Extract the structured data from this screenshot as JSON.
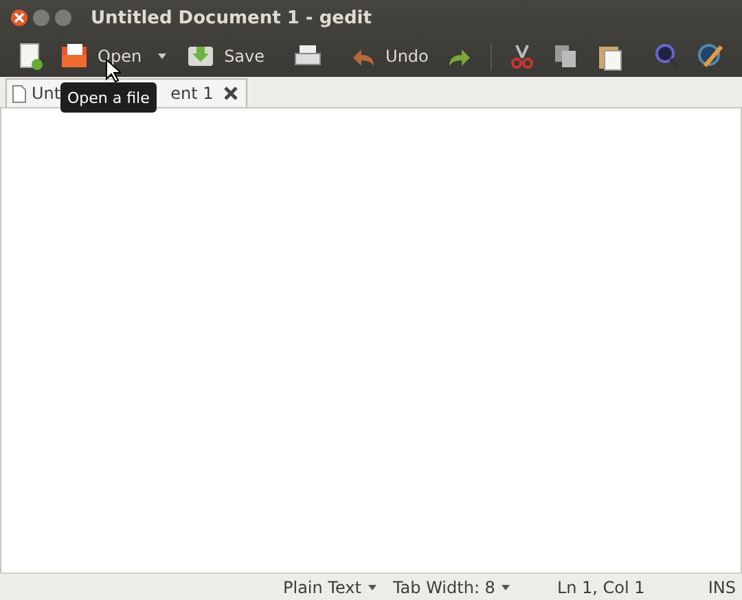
{
  "window": {
    "title": "Untitled Document 1 - gedit"
  },
  "toolbar": {
    "open_label": "Open",
    "save_label": "Save",
    "undo_label": "Undo"
  },
  "tabs": [
    {
      "label_start": "Unt",
      "label_end": "ent 1",
      "selected": true
    }
  ],
  "tooltip": "Open a file",
  "status_bar": {
    "language": "Plain Text",
    "tab_width": "Tab Width:  8",
    "position": "Ln 1, Col 1",
    "mode": "INS"
  }
}
